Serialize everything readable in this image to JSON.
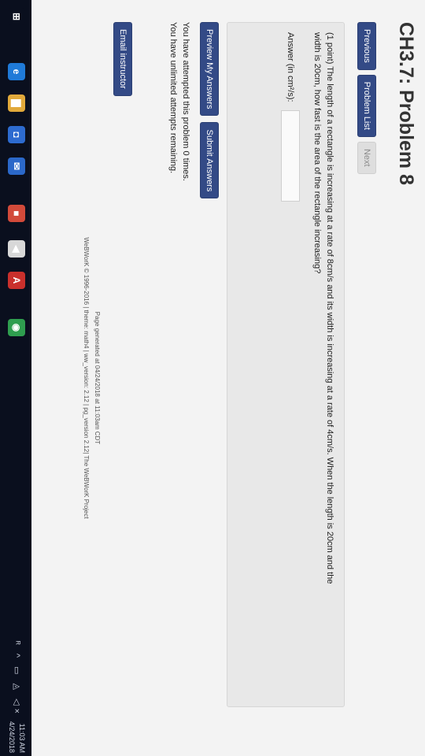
{
  "title": "CH3.7: Problem 8",
  "nav": {
    "previous": "Previous",
    "problem_list": "Problem List",
    "next": "Next"
  },
  "problem": {
    "line1": "(1 point) The length of a rectangle is increasing at a rate of 8cm/s and its width is increasing at a rate of 4cm/s. When the length is 20cm and the",
    "line2": "width is 20cm, how fast is the area of the rectangle increasing?",
    "answer_label": "Answer (in cm²/s):",
    "answer_value": ""
  },
  "actions": {
    "preview": "Preview My Answers",
    "submit": "Submit Answers"
  },
  "attempts": {
    "line1": "You have attempted this problem 0 times.",
    "line2": "You have unlimited attempts remaining."
  },
  "email": "Email instructor",
  "footer": {
    "line1": "Page generated at 04/24/2018 at 11:03am CDT",
    "line2": "WeBWorK © 1996-2016 | theme: math4 | ww_version: 2.12 | pg_version 2.12| The WeBWorK Project"
  },
  "taskbar": {
    "icons": [
      {
        "name": "start-icon",
        "glyph": "⊞",
        "color": "#0a0f1e"
      },
      {
        "name": "edge-icon",
        "glyph": "e",
        "color": "#1f7ad8"
      },
      {
        "name": "folder-icon",
        "glyph": "▇",
        "color": "#e1a93b"
      },
      {
        "name": "store-icon",
        "glyph": "◘",
        "color": "#2d6bd0"
      },
      {
        "name": "mail-icon",
        "glyph": "✉",
        "color": "#2b68c9"
      },
      {
        "name": "app-red-icon",
        "glyph": "■",
        "color": "#d24a3a"
      },
      {
        "name": "app-white-icon",
        "glyph": "◀",
        "color": "#d8d8d8"
      },
      {
        "name": "acrobat-icon",
        "glyph": "A",
        "color": "#c9302c"
      },
      {
        "name": "chrome-icon",
        "glyph": "◉",
        "color": "#2f9e4f"
      }
    ],
    "tray": "ᴿ ^ ▭ ◬ ◁×",
    "time": "11:03 AM",
    "date": "4/24/2018"
  }
}
